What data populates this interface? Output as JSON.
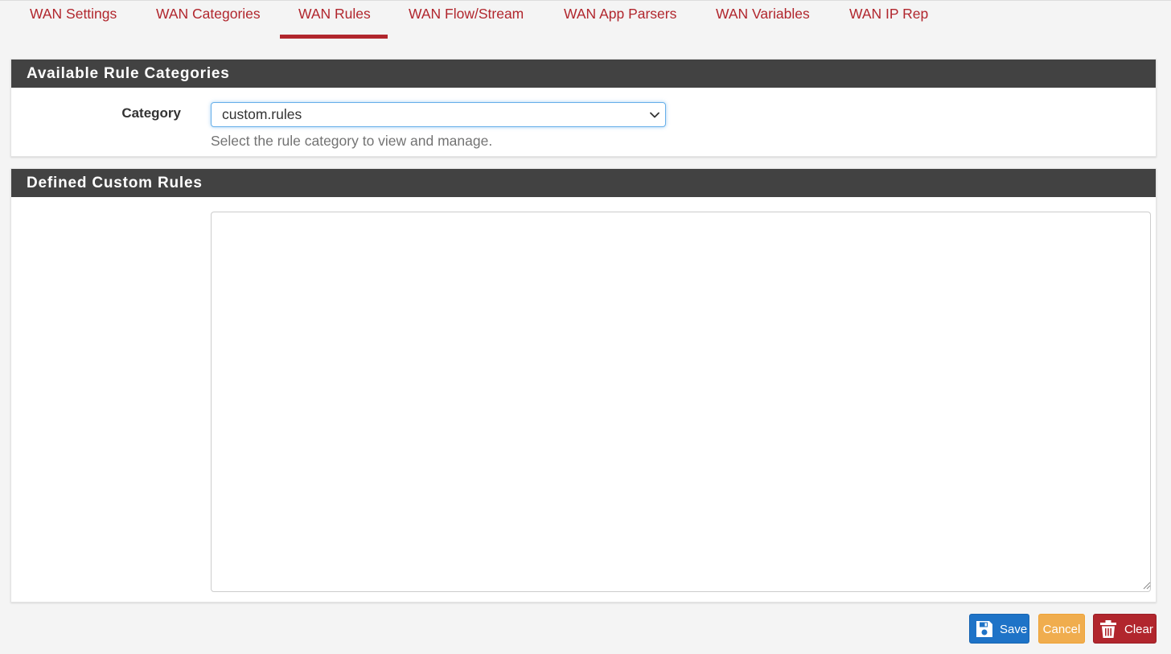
{
  "tabs": [
    {
      "label": "WAN Settings",
      "active": false
    },
    {
      "label": "WAN Categories",
      "active": false
    },
    {
      "label": "WAN Rules",
      "active": true
    },
    {
      "label": "WAN Flow/Stream",
      "active": false
    },
    {
      "label": "WAN App Parsers",
      "active": false
    },
    {
      "label": "WAN Variables",
      "active": false
    },
    {
      "label": "WAN IP Rep",
      "active": false
    }
  ],
  "categories_panel": {
    "title": "Available Rule Categories",
    "category_label": "Category",
    "selected_category": "custom.rules",
    "help_text": "Select the rule category to view and manage."
  },
  "rules_panel": {
    "title": "Defined Custom Rules",
    "rules_text": ""
  },
  "buttons": {
    "save": "Save",
    "cancel": "Cancel",
    "clear": "Clear"
  },
  "colors": {
    "accent": "#b1262d",
    "panel_heading": "#424242",
    "save": "#1e73c7",
    "cancel": "#f0ad4e",
    "clear": "#b1262d"
  },
  "icons": {
    "select": "chevron-down-icon",
    "save": "floppy-disk-icon",
    "clear": "trash-icon"
  }
}
